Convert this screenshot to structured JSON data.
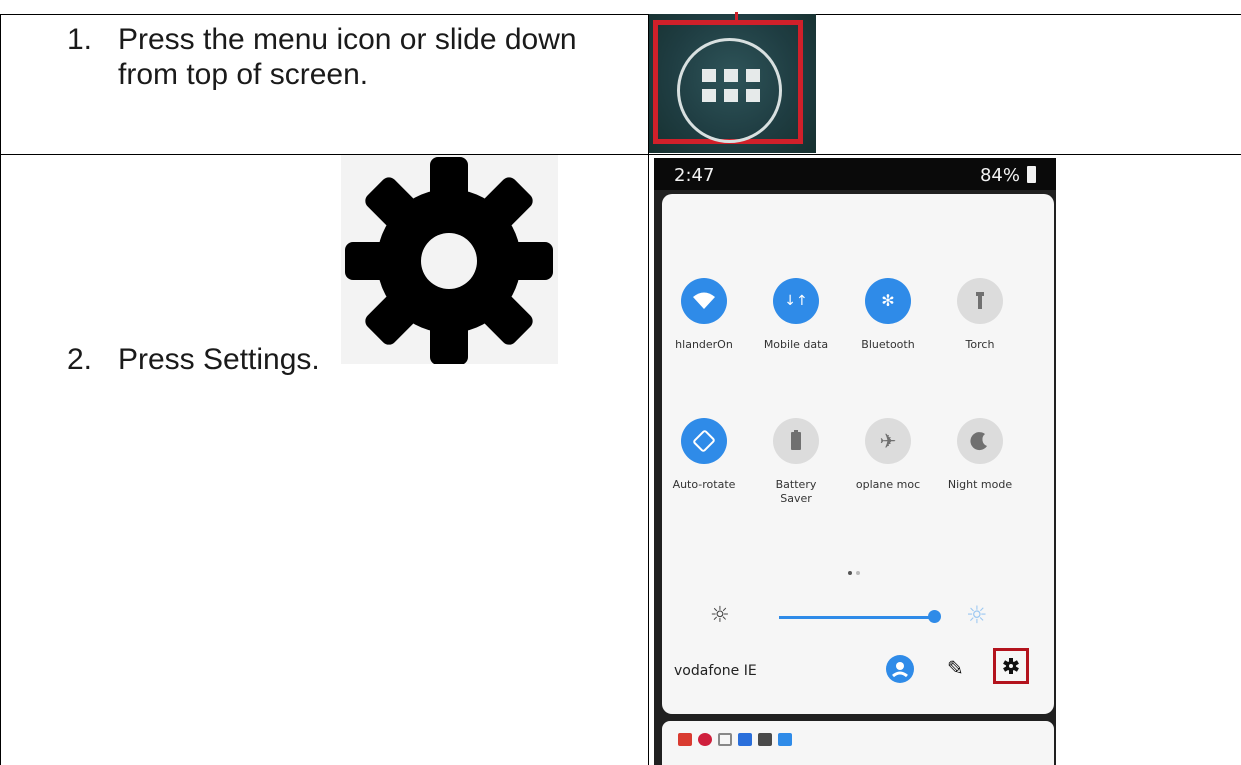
{
  "steps": [
    {
      "number": "1.",
      "text_line1": "Press the menu icon or slide down",
      "text_line2": "from top of screen."
    },
    {
      "number": "2.",
      "text": "Press Settings."
    }
  ],
  "phone": {
    "status": {
      "time": "2:47",
      "battery": "84%"
    },
    "tiles": [
      {
        "label": "hlanderOn",
        "icon": "wifi-icon",
        "state": "on"
      },
      {
        "label": "Mobile data",
        "icon": "mobile-data-icon",
        "state": "on"
      },
      {
        "label": "Bluetooth",
        "icon": "bluetooth-icon",
        "state": "on"
      },
      {
        "label": "Torch",
        "icon": "torch-icon",
        "state": "off"
      },
      {
        "label": "Auto-rotate",
        "icon": "auto-rotate-icon",
        "state": "on"
      },
      {
        "label": "Battery Saver",
        "icon": "battery-saver-icon",
        "state": "off"
      },
      {
        "label": "oplane moc",
        "icon": "airplane-icon",
        "state": "off"
      },
      {
        "label": "Night mode",
        "icon": "night-mode-icon",
        "state": "off"
      }
    ],
    "brightness": {
      "level": 0.95
    },
    "carrier": "vodafone IE",
    "app_icons": [
      "gmail-icon",
      "pinterest-icon",
      "instagram-icon",
      "dropbox-icon",
      "gallery-icon",
      "calendar-icon"
    ]
  },
  "colors": {
    "accent": "#2f8be8",
    "highlight_red": "#d0202a",
    "tile_off": "#dcdcdc"
  }
}
